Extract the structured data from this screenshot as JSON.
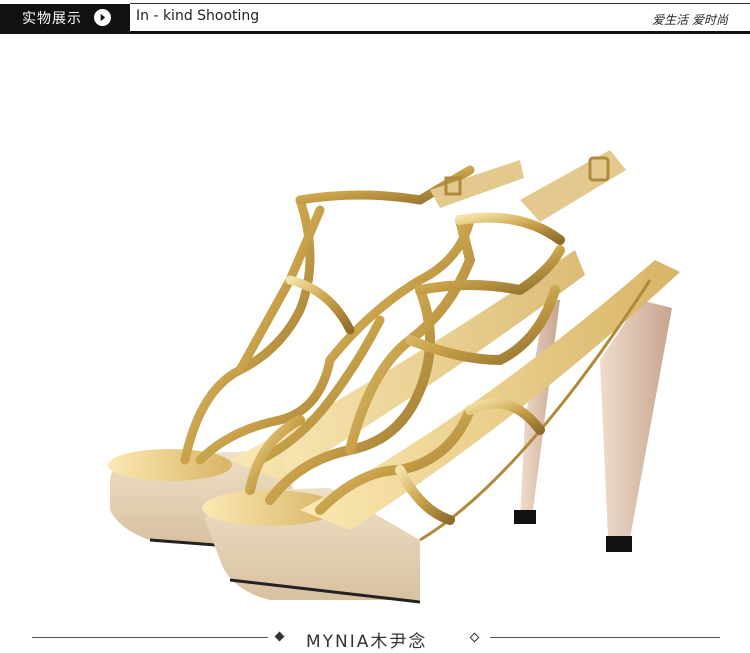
{
  "header": {
    "tab_label": "实物展示",
    "subtitle": "In - kind Shooting",
    "slogan": "爱生活 爱时尚"
  },
  "product": {
    "icon": "high-heel-sandal-photo",
    "colors": {
      "gold": "#c9a24a",
      "beige": "#e7d3b6",
      "heel": "#d9b9a6"
    }
  },
  "footer": {
    "brand": "MYNIA木尹念"
  }
}
